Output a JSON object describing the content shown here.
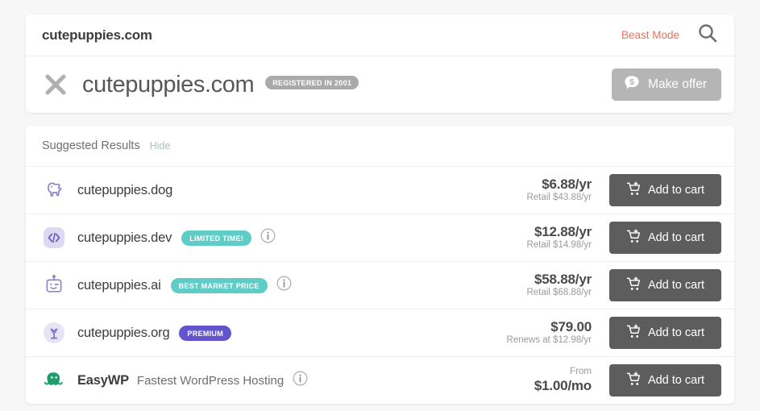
{
  "search": {
    "query": "cutepuppies.com",
    "beast_mode_label": "Beast Mode",
    "beast_mode_color": "#e8735a",
    "search_icon": "search-icon"
  },
  "domain_header": {
    "close_icon": "close-x-icon",
    "domain": "cutepuppies.com",
    "registered_badge": "REGISTERED IN 2001",
    "make_offer_label": "Make offer",
    "make_offer_icon": "dollar-bubble-icon",
    "make_offer_color": "#b5b5b5"
  },
  "results": {
    "title": "Suggested Results",
    "hide_label": "Hide",
    "cart_button_label": "Add to cart",
    "cart_icon": "cart-plus-icon",
    "rows": [
      {
        "icon": "dog-icon",
        "name": "cutepuppies.dog",
        "sub": "",
        "badge": "",
        "badge_style": "",
        "info": false,
        "price_pre": "",
        "price_main": "$6.88/yr",
        "price_sub": "Retail $43.88/yr",
        "cart": "Add to cart"
      },
      {
        "icon": "code-icon",
        "name": "cutepuppies.dev",
        "sub": "",
        "badge": "LIMITED TIME!",
        "badge_style": "teal",
        "info": true,
        "price_pre": "",
        "price_main": "$12.88/yr",
        "price_sub": "Retail $14.98/yr",
        "cart": "Add to cart"
      },
      {
        "icon": "robot-icon",
        "name": "cutepuppies.ai",
        "sub": "",
        "badge": "BEST MARKET PRICE",
        "badge_style": "teal",
        "info": true,
        "price_pre": "",
        "price_main": "$58.88/yr",
        "price_sub": "Retail $68.88/yr",
        "cart": "Add to cart"
      },
      {
        "icon": "plant-icon",
        "name": "cutepuppies.org",
        "sub": "",
        "badge": "PREMIUM",
        "badge_style": "purple",
        "info": false,
        "price_pre": "",
        "price_main": "$79.00",
        "price_sub": "Renews at $12.98/yr",
        "cart": "Add to cart"
      },
      {
        "icon": "octopus-icon",
        "name": "EasyWP",
        "sub": "Fastest WordPress Hosting",
        "badge": "",
        "badge_style": "",
        "info": true,
        "price_pre": "From",
        "price_main": "$1.00/mo",
        "price_sub": "",
        "cart": "Add to cart"
      }
    ]
  },
  "colors": {
    "teal_badge": "#5ecdc8",
    "purple_badge": "#6254cc",
    "cart_button": "#5d5d5d",
    "icon_purple": "#8d86c9",
    "icon_green": "#1f9d6b",
    "page_bg": "#f7f7f7"
  }
}
